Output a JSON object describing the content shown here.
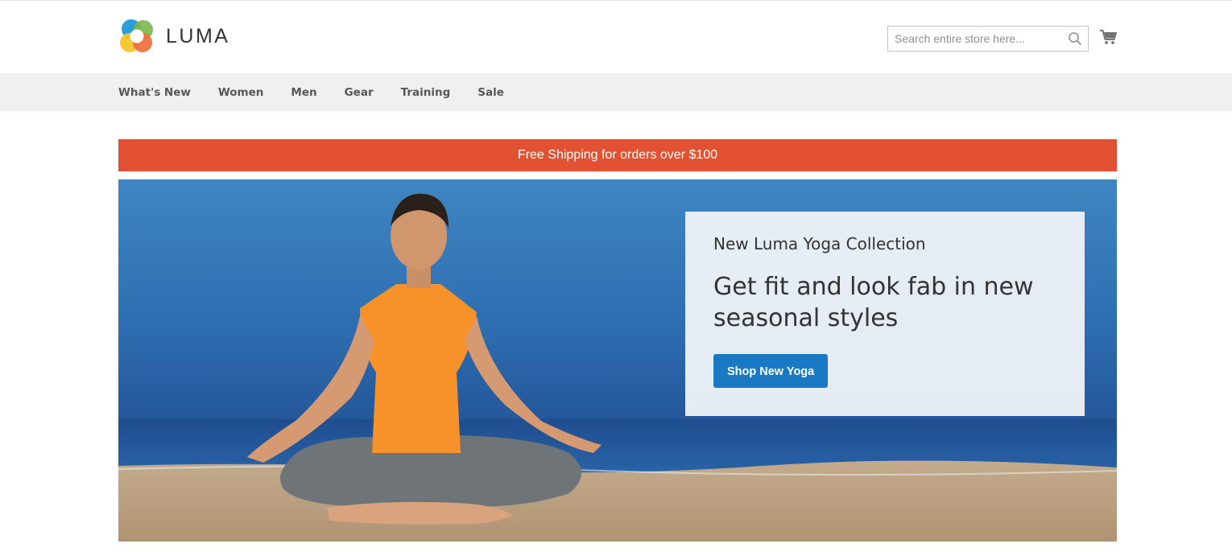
{
  "header": {
    "logo_text": "LUMA",
    "search_placeholder": "Search entire store here...",
    "cart_icon": "shopping-cart-icon",
    "search_icon": "magnifier-icon"
  },
  "nav": {
    "items": [
      {
        "label": "What's New"
      },
      {
        "label": "Women"
      },
      {
        "label": "Men"
      },
      {
        "label": "Gear"
      },
      {
        "label": "Training"
      },
      {
        "label": "Sale"
      }
    ]
  },
  "promo": {
    "text": "Free Shipping for orders over $100",
    "color": "#e25232"
  },
  "hero": {
    "kicker": "New Luma Yoga Collection",
    "headline": "Get fit and look fab in new seasonal styles",
    "button_label": "Shop New Yoga",
    "button_color": "#1979c3"
  }
}
